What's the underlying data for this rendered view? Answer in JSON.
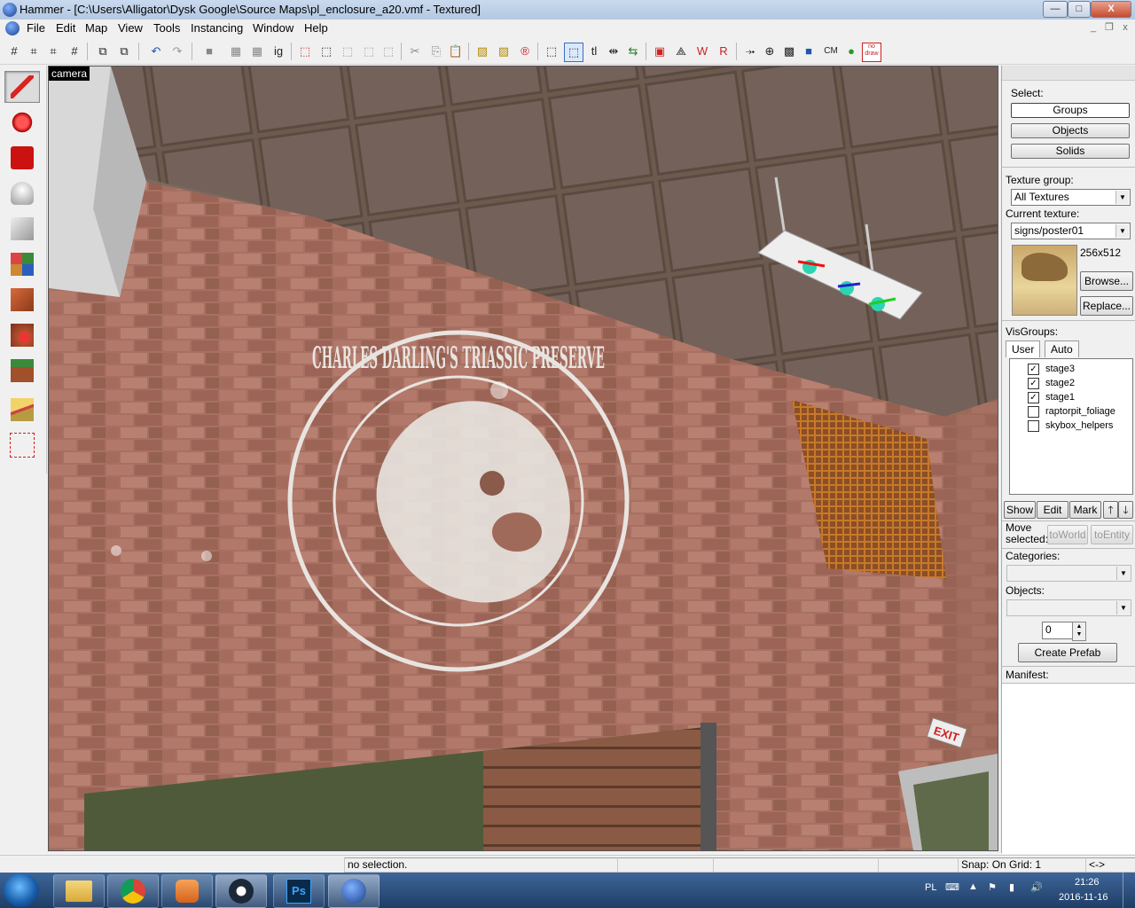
{
  "window": {
    "title": "Hammer - [C:\\Users\\Alligator\\Dysk Google\\Source Maps\\pl_enclosure_a20.vmf - Textured]",
    "controls": {
      "minimize": "—",
      "maximize": "□",
      "close": "X"
    }
  },
  "menu": {
    "items": [
      "File",
      "Edit",
      "Map",
      "View",
      "Tools",
      "Instancing",
      "Window",
      "Help"
    ],
    "mdi_controls": {
      "minimize": "_",
      "restore": "❐",
      "close": "x"
    }
  },
  "toolbar": {
    "labels": {
      "ig": "ig",
      "tl": "tl",
      "cm": "CM",
      "nodraw": "no draw"
    }
  },
  "viewport": {
    "label": "camera",
    "logo_text": "CHARLES DARLING'S TRIASSIC PRESERVE",
    "exit_sign": "EXIT"
  },
  "right_panel": {
    "select_label": "Select:",
    "select_buttons": [
      "Groups",
      "Objects",
      "Solids"
    ],
    "texture_group_label": "Texture group:",
    "texture_group_value": "All Textures",
    "current_texture_label": "Current texture:",
    "current_texture_value": "signs/poster01",
    "texture_size": "256x512",
    "browse_button": "Browse...",
    "replace_button": "Replace...",
    "visgroups_label": "VisGroups:",
    "visgroup_tabs": [
      "User",
      "Auto"
    ],
    "visgroups": [
      {
        "name": "stage3",
        "checked": true
      },
      {
        "name": "stage2",
        "checked": true
      },
      {
        "name": "stage1",
        "checked": true
      },
      {
        "name": "raptorpit_foliage",
        "checked": false
      },
      {
        "name": "skybox_helpers",
        "checked": false
      }
    ],
    "visgroup_buttons": {
      "show": "Show",
      "edit": "Edit",
      "mark": "Mark",
      "up": "🡑",
      "down": "🡓"
    },
    "move_selected_label": "Move selected:",
    "to_world_button": "toWorld",
    "to_entity_button": "toEntity",
    "categories_label": "Categories:",
    "objects_label": "Objects:",
    "stepper_value": "0",
    "create_prefab_button": "Create Prefab",
    "manifest_label": "Manifest:"
  },
  "status_bar": {
    "selection": "no selection.",
    "snap": "Snap: On Grid: 1",
    "arrows": "<->"
  },
  "taskbar": {
    "language": "PL",
    "time": "21:26",
    "date": "2016-11-16"
  },
  "colors": {
    "titlebar": "#b4c8e2",
    "taskbar": "#1f3d66",
    "brick": "#a86f5e",
    "ceiling": "#6e5b50",
    "logo": "#e8e4e0",
    "grate": "#d98a2c"
  }
}
